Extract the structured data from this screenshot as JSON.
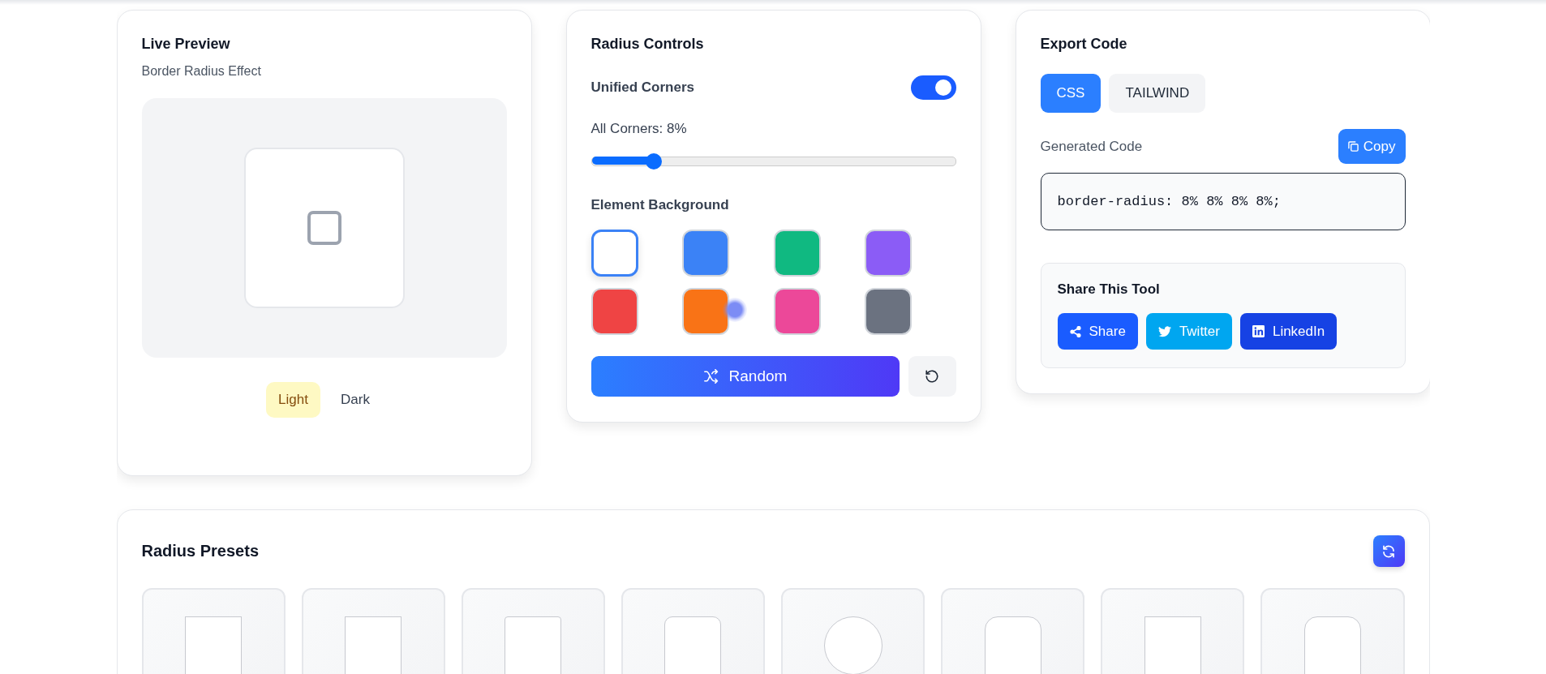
{
  "preview": {
    "title": "Live Preview",
    "subtitle": "Border Radius Effect",
    "modes": [
      {
        "label": "Light",
        "selected": true
      },
      {
        "label": "Dark",
        "selected": false
      }
    ]
  },
  "controls": {
    "title": "Radius Controls",
    "unified": {
      "label": "Unified Corners",
      "on": true
    },
    "slider": {
      "label": "All Corners: 8%",
      "level": 0.17
    },
    "background": {
      "label": "Element Background",
      "swatches": [
        {
          "color": "#ffffff",
          "selected": true
        },
        {
          "color": "#3b82f6",
          "selected": false
        },
        {
          "color": "#10b981",
          "selected": false
        },
        {
          "color": "#8b5cf6",
          "selected": false
        },
        {
          "color": "#ef4444",
          "selected": false
        },
        {
          "color": "#f97316",
          "selected": false
        },
        {
          "color": "#ec4899",
          "selected": false
        },
        {
          "color": "#6b7280",
          "selected": false
        }
      ]
    },
    "random_button": "Random"
  },
  "export": {
    "title": "Export Code",
    "tabs": [
      {
        "label": "CSS",
        "selected": true
      },
      {
        "label": "TAILWIND",
        "selected": false
      }
    ],
    "code_label": "Generated Code",
    "copy_button": "Copy",
    "code": "border-radius: 8% 8% 8% 8%;",
    "share": {
      "title": "Share This Tool",
      "buttons": [
        {
          "kind": "share",
          "label": "Share"
        },
        {
          "kind": "twitter",
          "label": "Twitter"
        },
        {
          "kind": "linkedin",
          "label": "LinkedIn"
        }
      ]
    }
  },
  "presets": {
    "title": "Radius Presets",
    "items": [
      {
        "kind": "sharp"
      },
      {
        "kind": "sharp"
      },
      {
        "kind": "small"
      },
      {
        "kind": "medium"
      },
      {
        "kind": "circle"
      },
      {
        "kind": "large"
      },
      {
        "kind": "sharp"
      },
      {
        "kind": "large"
      }
    ]
  }
}
